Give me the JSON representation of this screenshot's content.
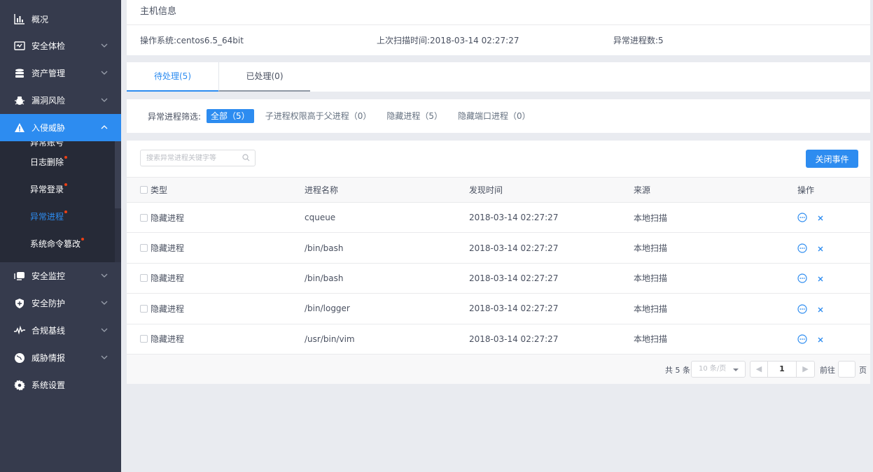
{
  "sidebar": {
    "items": [
      {
        "label": "概况",
        "icon": "bar-chart-icon"
      },
      {
        "label": "安全体检",
        "icon": "monitor-check-icon"
      },
      {
        "label": "资产管理",
        "icon": "database-icon"
      },
      {
        "label": "漏洞风险",
        "icon": "bug-icon"
      },
      {
        "label": "入侵威胁",
        "icon": "warning-icon"
      },
      {
        "label": "安全监控",
        "icon": "monitor-icon"
      },
      {
        "label": "安全防护",
        "icon": "shield-icon"
      },
      {
        "label": "合规基线",
        "icon": "pulse-icon"
      },
      {
        "label": "威胁情报",
        "icon": "globe-icon"
      },
      {
        "label": "系统设置",
        "icon": "gear-icon"
      }
    ],
    "submenu": [
      {
        "label": "异常账号"
      },
      {
        "label": "日志删除"
      },
      {
        "label": "异常登录"
      },
      {
        "label": "异常进程"
      },
      {
        "label": "系统命令篡改"
      }
    ]
  },
  "host": {
    "title": "主机信息",
    "os": "操作系统:centos6.5_64bit",
    "last_scan": "上次扫描时间:2018-03-14 02:27:27",
    "abnormal_count": "异常进程数:5"
  },
  "tabs": {
    "pending": "待处理(5)",
    "handled": "已处理(0)"
  },
  "filter": {
    "label": "异常进程筛选:",
    "chips": [
      "全部（5）",
      "子进程权限高于父进程（0）",
      "隐藏进程（5）",
      "隐藏端口进程（0）"
    ]
  },
  "list": {
    "search_placeholder": "搜索异常进程关键字等",
    "close_button": "关闭事件",
    "columns": [
      "类型",
      "进程名称",
      "发现时间",
      "来源",
      "操作"
    ],
    "rows": [
      {
        "type": "隐藏进程",
        "name": "cqueue",
        "time": "2018-03-14 02:27:27",
        "source": "本地扫描"
      },
      {
        "type": "隐藏进程",
        "name": "/bin/bash",
        "time": "2018-03-14 02:27:27",
        "source": "本地扫描"
      },
      {
        "type": "隐藏进程",
        "name": "/bin/bash",
        "time": "2018-03-14 02:27:27",
        "source": "本地扫描"
      },
      {
        "type": "隐藏进程",
        "name": "/bin/logger",
        "time": "2018-03-14 02:27:27",
        "source": "本地扫描"
      },
      {
        "type": "隐藏进程",
        "name": "/usr/bin/vim",
        "time": "2018-03-14 02:27:27",
        "source": "本地扫描"
      }
    ]
  },
  "pager": {
    "total": "共 5 条",
    "page_size": "10 条/页",
    "current_page": "1",
    "goto_label": "前往",
    "page_unit": "页"
  },
  "colors": {
    "sidebar_bg": "#363b4d",
    "submenu_bg": "#262a37",
    "accent": "#2d8cf0",
    "dot": "#ed3f14"
  }
}
